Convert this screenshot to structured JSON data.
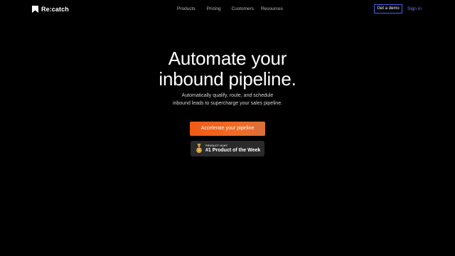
{
  "header": {
    "logo_text": "Re:catch",
    "nav": [
      "Products",
      "Pricing",
      "Customers",
      "Resources"
    ],
    "demo_label": "Get a demo",
    "signin_label": "Sign in"
  },
  "hero": {
    "title_lines": [
      "Automate your",
      "inbound pipeline."
    ],
    "subtitle_lines": [
      "Automatically qualify, route, and schedule",
      "inbound leads to supercharge your sales pipeline."
    ],
    "cta_label": "Accelerate your pipeline"
  },
  "badge": {
    "small_text": "PRODUCT HUNT",
    "big_text": "#1 Product of the Week",
    "icon": "medal-icon"
  },
  "colors": {
    "background": "#000000",
    "accent_orange": "#f05a14",
    "accent_blue": "#4f5ff7",
    "badge_bg": "#2a2a2a"
  }
}
